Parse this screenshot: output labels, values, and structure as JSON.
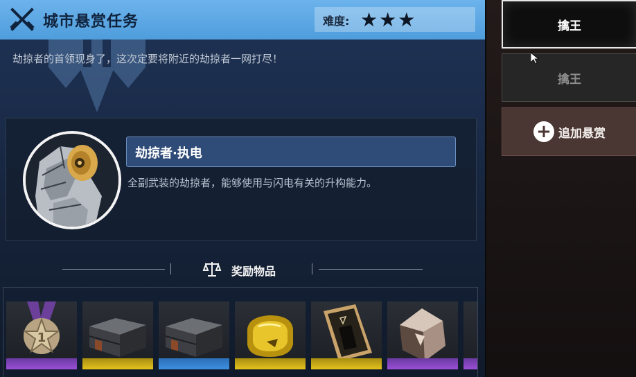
{
  "header": {
    "title": "城市悬赏任务",
    "difficulty_label": "难度:",
    "difficulty_stars": "★★★",
    "difficulty_value": 3
  },
  "description": "劫掠者的首领现身了，这次定要将附近的劫掠者一网打尽！",
  "boss": {
    "name": "劫掠者·执电",
    "description": "全副武装的劫掠者，能够使用与闪电有关的升构能力。"
  },
  "rewards": {
    "label": "奖励物品",
    "items": [
      {
        "icon": "medal-icon",
        "rarity_color": "#9b4fd8"
      },
      {
        "icon": "supply-crate-icon",
        "rarity_color": "#e3c21c"
      },
      {
        "icon": "supply-crate-icon",
        "rarity_color": "#3e8fe0"
      },
      {
        "icon": "gold-chip-icon",
        "rarity_color": "#e3c21c"
      },
      {
        "icon": "data-card-icon",
        "rarity_color": "#e3c21c"
      },
      {
        "icon": "crystal-icon",
        "rarity_color": "#9b4fd8"
      }
    ]
  },
  "sidebar": {
    "items": [
      {
        "label": "擒王",
        "state": "selected"
      },
      {
        "label": "擒王",
        "state": "normal"
      }
    ],
    "add_label": "追加悬赏"
  },
  "colors": {
    "header": "#5ba6e4",
    "name_box": "#2f4c78",
    "rarity_purple": "#9b4fd8",
    "rarity_gold": "#e3c21c",
    "rarity_blue": "#3e8fe0"
  }
}
